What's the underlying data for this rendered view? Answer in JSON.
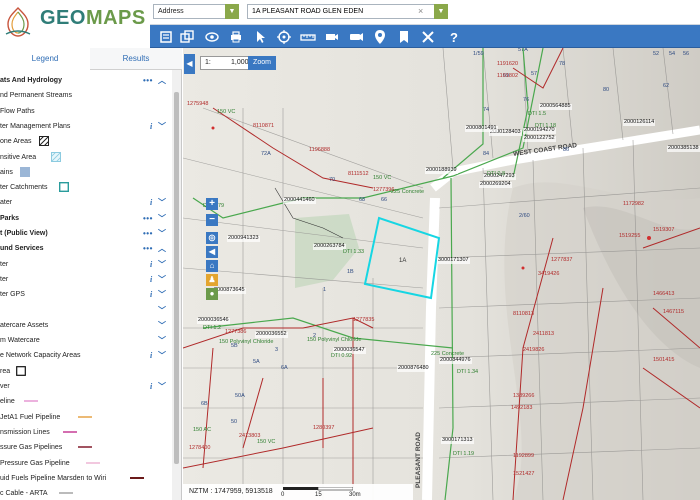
{
  "app": {
    "logo_text_a": "GEO",
    "logo_text_b": "MAPS"
  },
  "search": {
    "type_label": "Address",
    "value": "1A PLEASANT ROAD GLEN EDEN"
  },
  "tabs": {
    "legend": "Legend",
    "results": "Results"
  },
  "legend": [
    {
      "label": "ats And Hydrology",
      "kind": "header",
      "dots": true,
      "chevron": "up"
    },
    {
      "label": "nd Permanent Streams",
      "kind": "item"
    },
    {
      "label": "Flow Paths",
      "kind": "item"
    },
    {
      "label": "ter Management Plans",
      "kind": "item",
      "info": true,
      "chevron": "down"
    },
    {
      "label": "one Areas",
      "kind": "item",
      "swatch": "hatch"
    },
    {
      "label": "nsitive Area",
      "kind": "item",
      "swatch": "light-hatch"
    },
    {
      "label": "ains",
      "kind": "item",
      "swatch": "blue-fill"
    },
    {
      "label": "ter Catchments",
      "kind": "item",
      "swatch": "teal-outline"
    },
    {
      "label": "ater",
      "kind": "item",
      "info": true,
      "chevron": "down"
    },
    {
      "label": "Parks",
      "kind": "header",
      "dots": true,
      "chevron": "down"
    },
    {
      "label": "t (Public View)",
      "kind": "header",
      "dots": true,
      "chevron": "down"
    },
    {
      "label": "und Services",
      "kind": "header",
      "dots": true,
      "chevron": "up"
    },
    {
      "label": "ter",
      "kind": "item",
      "info": true,
      "chevron": "down"
    },
    {
      "label": "ter",
      "kind": "item",
      "info": true,
      "chevron": "down"
    },
    {
      "label": "ter GPS",
      "kind": "item",
      "info": true,
      "chevron": "down"
    },
    {
      "label": "",
      "kind": "item",
      "chevron": "down"
    },
    {
      "label": "atercare Assets",
      "kind": "item",
      "chevron": "down"
    },
    {
      "label": "m Watercare",
      "kind": "item",
      "chevron": "down"
    },
    {
      "label": "e Network Capacity Areas",
      "kind": "item",
      "info": true,
      "chevron": "down"
    },
    {
      "label": "rea",
      "kind": "item",
      "swatch": "black-outline"
    },
    {
      "label": "ver",
      "kind": "item",
      "info": true,
      "chevron": "down"
    },
    {
      "label": "eline",
      "kind": "item",
      "swatch": "line-pink"
    },
    {
      "label": "JetA1 Fuel Pipeline",
      "kind": "item",
      "swatch": "line-orange"
    },
    {
      "label": "nsmission Lines",
      "kind": "item",
      "swatch": "line-magenta"
    },
    {
      "label": "ssure Gas Pipelines",
      "kind": "item",
      "swatch": "line-maroon"
    },
    {
      "label": "Pressure Gas Pipeline",
      "kind": "item",
      "swatch": "line-pink2"
    },
    {
      "label": "uid Fuels Pipeline Marsden to Wiri",
      "kind": "item",
      "swatch": "line-darkred"
    },
    {
      "label": "c Cable - ARTA",
      "kind": "item",
      "swatch": "line-thin"
    }
  ],
  "map": {
    "scale_prefix": "1:",
    "scale_value": "1,000",
    "zoom_label": "Zoom",
    "coords_text": "NZTM : 1747959, 5913518",
    "scale_labels": [
      "0",
      "15",
      "30m"
    ],
    "road_west_coast": "WEST COAST ROAD",
    "road_pleasant": "PLEASANT ROAD",
    "parcel_selected": "1A",
    "parcel_labels": [
      "72A",
      "66",
      "68",
      "70",
      "1B",
      "1",
      "2",
      "3",
      "5B",
      "5A",
      "6B",
      "6A",
      "50A",
      "50",
      "1/59",
      "57A",
      "2/60",
      "57",
      "69",
      "52",
      "54",
      "56",
      "62",
      "74",
      "76",
      "78",
      "80",
      "84",
      "86"
    ],
    "asset_ids": [
      "2000941323",
      "2000873645",
      "2000188939",
      "2000247293",
      "2000269204",
      "2000441460",
      "2000263784",
      "2000036546",
      "2000036547",
      "2000036552",
      "2000876480",
      "2000844976",
      "2000126114",
      "2000385138",
      "2000194270",
      "2000122752",
      "2000128403",
      "2000801491",
      "3000171313",
      "3000171307",
      "2000564885"
    ],
    "pipe_labels": [
      "DTI 1.79",
      "DTI 1.33",
      "DTI 1.2",
      "DTI 0.92",
      "DTI 1.34",
      "DTI 1.19",
      "DTI 0.8",
      "DTI 1.5",
      "DTI 1.18",
      "225 Concrete",
      "225 Concrete",
      "150 Polyvinyl Chloride",
      "150 Polyvinyl Chloride",
      "150 VC",
      "150 VC",
      "150 VC",
      "150 AC"
    ],
    "wastewater_ids": [
      "1196888",
      "1277396",
      "1275948",
      "1277835",
      "1277386",
      "1278400",
      "1280397",
      "1277837",
      "1191620",
      "1191802",
      "1192899",
      "1172982",
      "1519255",
      "1519307",
      "1466413",
      "1467115",
      "1501415",
      "1389266",
      "1492183",
      "1521427",
      "8110871",
      "8111512",
      "8110813",
      "2411813",
      "2413803",
      "2419826",
      "3419426"
    ]
  }
}
